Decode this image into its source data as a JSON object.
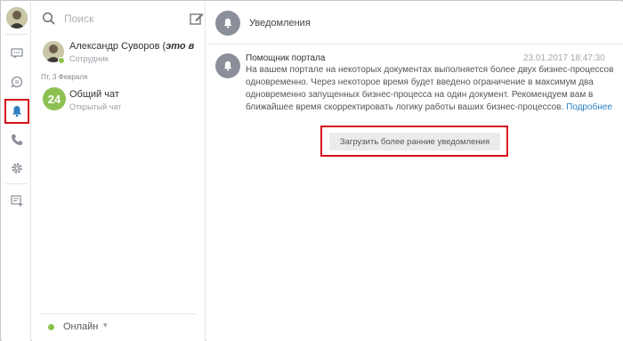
{
  "rail": {
    "icons": [
      "user-avatar",
      "chat-bubble-icon",
      "history-search-icon",
      "bell-icon",
      "phone-icon",
      "gear-icon",
      "add-chat-icon"
    ],
    "active_color": "#d8101b"
  },
  "contacts": {
    "search_placeholder": "Поиск",
    "items": [
      {
        "name": "Александр Суворов (",
        "name_em": "это в",
        "subtitle": "Сотрудник"
      },
      {
        "name": "Общий чат",
        "badge": "24",
        "subtitle": "Открытый чат"
      }
    ],
    "date_divider": "Пт, 3 Февраля",
    "status": {
      "label": "Онлайн",
      "color": "#8bc34a"
    }
  },
  "main": {
    "header_title": "Уведомления",
    "notification": {
      "author": "Помощник портала",
      "time": "23.01.2017 18:47:30",
      "text": "На вашем портале на некоторых документах выполняется более двух бизнес-процессов одновременно. Через некоторое время будет введено ограничение в максимум два одновременно запущенных бизнес-процесса на один документ. Рекомендуем вам в ближайшее время скорректировать логику работы ваших бизнес-процессов.",
      "more_link": "Подробнее"
    },
    "load_more_label": "Загрузить более ранние уведомления"
  }
}
